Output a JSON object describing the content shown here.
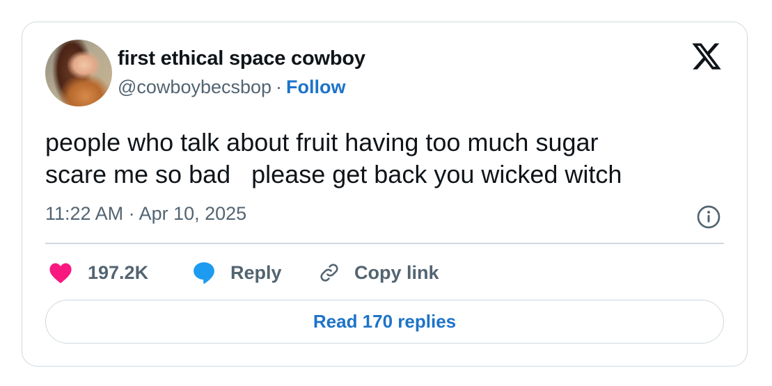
{
  "author": {
    "display_name": "first ethical space cowboy",
    "handle": "@cowboybecsbop",
    "separator": "·",
    "follow_label": "Follow"
  },
  "logo": {
    "icon": "x-logo-icon"
  },
  "tweet": {
    "text": "people who talk about fruit having too much sugar\nscare me so bad   please get back you wicked witch",
    "timestamp": "11:22 AM · Apr 10, 2025",
    "info_icon": "info-icon"
  },
  "actions": {
    "like": {
      "count": "197.2K",
      "icon": "heart-icon",
      "color": "#f91880"
    },
    "reply": {
      "label": "Reply",
      "icon": "speech-bubble-icon",
      "color": "#1d9bf0"
    },
    "copy_link": {
      "label": "Copy link",
      "icon": "link-icon"
    }
  },
  "read_replies": {
    "label": "Read 170 replies"
  },
  "colors": {
    "accent": "#1d73c9",
    "secondary_text": "#536471",
    "border": "#cfd9de"
  }
}
